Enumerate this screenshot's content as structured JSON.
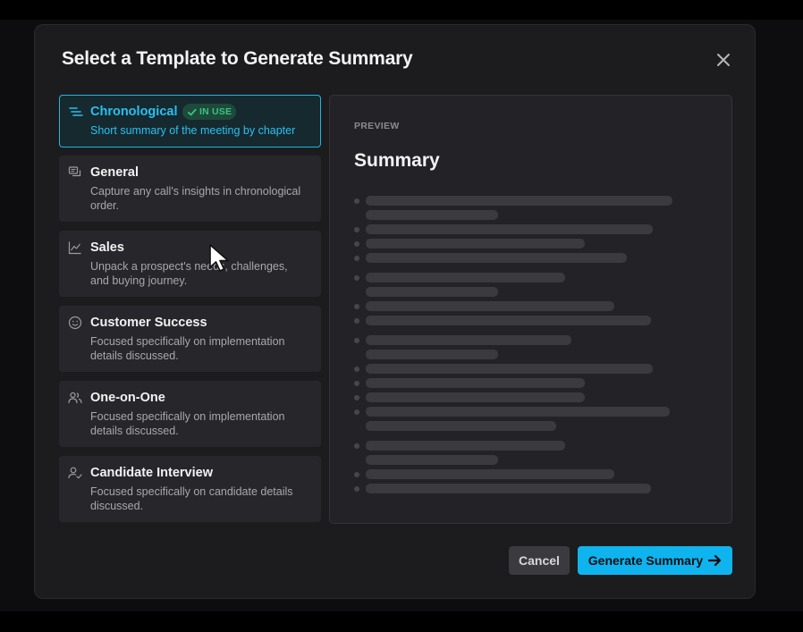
{
  "modal": {
    "title": "Select a Template to Generate Summary"
  },
  "templates": [
    {
      "name": "Chronological",
      "description": "Short summary of the meeting by chapter",
      "icon": "chronological-list-icon",
      "active": true,
      "badge": "IN USE"
    },
    {
      "name": "General",
      "description": "Capture any call's insights in chronological order.",
      "icon": "chat-bubbles-icon"
    },
    {
      "name": "Sales",
      "description": "Unpack a prospect's needs, challenges, and buying journey.",
      "icon": "line-chart-icon"
    },
    {
      "name": "Customer Success",
      "description": "Focused specifically on implementation details discussed.",
      "icon": "smiley-icon"
    },
    {
      "name": "One-on-One",
      "description": "Focused specifically on implementation details discussed.",
      "icon": "two-people-icon"
    },
    {
      "name": "Candidate Interview",
      "description": "Focused specifically on candidate details discussed.",
      "icon": "person-check-icon"
    }
  ],
  "preview": {
    "label": "PREVIEW",
    "heading": "Summary"
  },
  "footer": {
    "cancel_label": "Cancel",
    "generate_label": "Generate Summary"
  },
  "colors": {
    "accent": "#0fb4ee",
    "active_text": "#29c0f0",
    "badge_text": "#37c47f",
    "modal_bg": "#1c1c1f"
  }
}
